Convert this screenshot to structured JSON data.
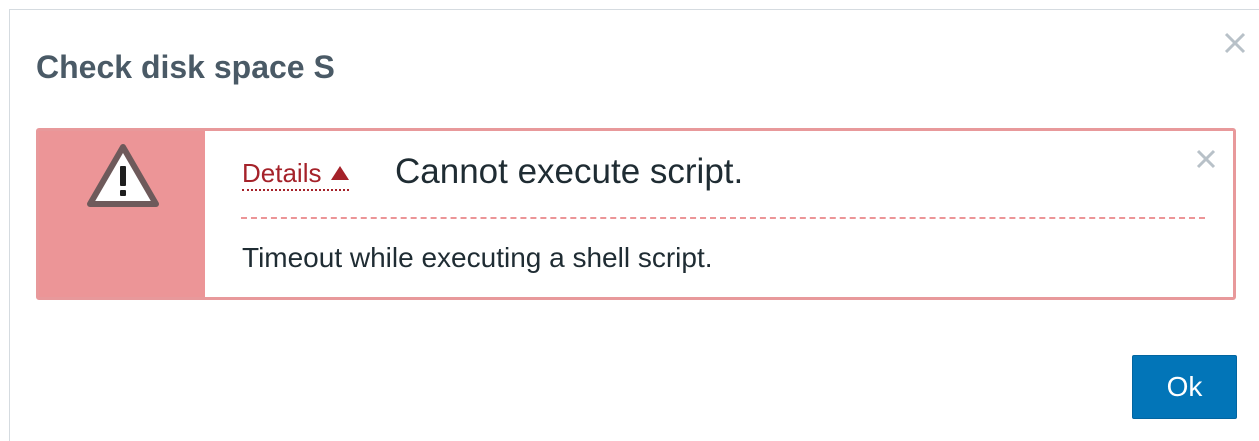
{
  "dialog": {
    "title": "Check disk space S",
    "close_icon": "close-icon",
    "ok_label": "Ok"
  },
  "message": {
    "type": "error",
    "icon": "warning-icon",
    "details_label": "Details",
    "details_toggle_icon": "triangle-up-icon",
    "title": "Cannot execute script.",
    "details": [
      "Timeout while executing a shell script."
    ],
    "close_icon": "close-icon"
  },
  "colors": {
    "error_background": "#ec9597",
    "error_border": "#e8999b",
    "details_link": "#a5222a",
    "title_text": "#4a5a66",
    "button": "#0275b8"
  }
}
